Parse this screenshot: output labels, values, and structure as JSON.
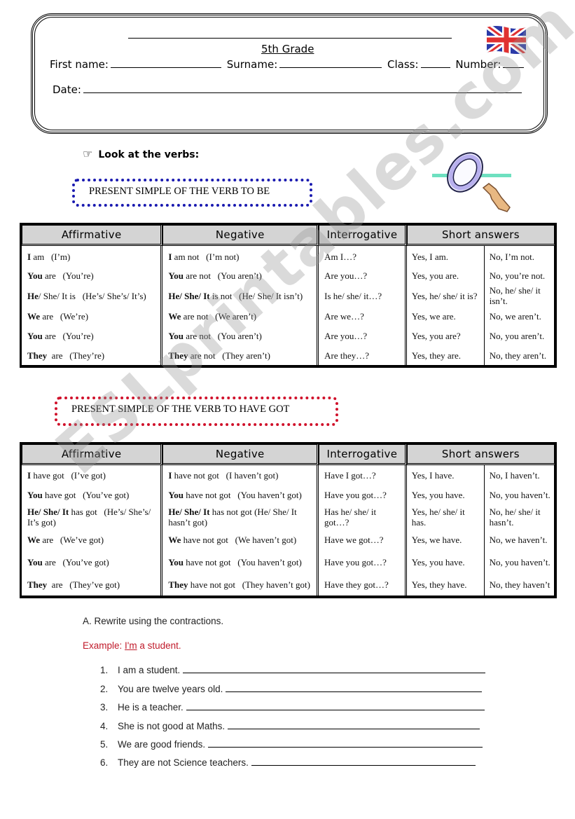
{
  "header": {
    "grade": "5th Grade",
    "first_name_label": "First name:",
    "surname_label": "Surname:",
    "class_label": "Class:",
    "number_label": "Number:",
    "date_label": "Date:",
    "flag_icon": "uk-flag-icon"
  },
  "intro": {
    "pointer_icon": "pointing-hand-icon",
    "pointer_glyph": "☞",
    "look_label": "Look at the verbs:",
    "magnifier_icon": "magnifying-glass-icon"
  },
  "section_to_be": {
    "title": "PRESENT SIMPLE OF THE VERB TO BE",
    "border_color": "#1a1ab0",
    "headers": [
      "Affirmative",
      "Negative",
      "Interrogative",
      "Short answers"
    ],
    "rows": [
      {
        "aff_subj": "I",
        "aff_rest": " am   (I’m)",
        "neg_subj": "I",
        "neg_rest": " am not   (I’m not)",
        "inter": "Am I…?",
        "yes": "Yes, I am.",
        "no": "No, I’m not."
      },
      {
        "aff_subj": "You",
        "aff_rest": " are   (You’re)",
        "neg_subj": "You",
        "neg_rest": " are not   (You aren’t)",
        "inter": "Are you…?",
        "yes": "Yes, you are.",
        "no": "No, you’re not."
      },
      {
        "aff_subj": "He",
        "aff_rest": "/ She/ It is   (He’s/ She’s/ It’s)",
        "neg_subj": "He/ She/ It",
        "neg_rest": " is not   (He/ She/ It isn’t)",
        "inter": "Is he/ she/ it…?",
        "yes": "Yes, he/ she/ it is?",
        "no": "No, he/ she/ it isn’t."
      },
      {
        "aff_subj": "We",
        "aff_rest": " are   (We’re)",
        "neg_subj": "We",
        "neg_rest": " are not   (We aren’t)",
        "inter": "Are we…?",
        "yes": "Yes, we are.",
        "no": "No, we aren’t."
      },
      {
        "aff_subj": "You",
        "aff_rest": " are   (You’re)",
        "neg_subj": "You",
        "neg_rest": " are not   (You aren’t)",
        "inter": "Are you…?",
        "yes": "Yes, you are?",
        "no": "No, you aren’t."
      },
      {
        "aff_subj": "They",
        "aff_rest": "  are   (They’re)",
        "neg_subj": "They",
        "neg_rest": " are not   (They aren’t)",
        "inter": "Are they…?",
        "yes": "Yes, they are.",
        "no": "No, they aren’t."
      }
    ]
  },
  "section_have_got": {
    "title": "PRESENT SIMPLE OF THE VERB TO HAVE GOT",
    "border_color": "#d0102a",
    "headers": [
      "Affirmative",
      "Negative",
      "Interrogative",
      "Short answers"
    ],
    "rows": [
      {
        "aff_subj": "I",
        "aff_rest": " have got   (I’ve got)",
        "neg_subj": "I",
        "neg_rest": " have not got   (I haven’t got)",
        "inter": "Have I got…?",
        "yes": "Yes, I have.",
        "no": "No, I haven’t."
      },
      {
        "aff_subj": "You",
        "aff_rest": " have got   (You’ve got)",
        "neg_subj": "You",
        "neg_rest": " have not got   (You haven’t got)",
        "inter": "Have you got…?",
        "yes": "Yes, you have.",
        "no": "No, you haven’t."
      },
      {
        "aff_subj": "He/ She/ It",
        "aff_rest": " has got   (He’s/ She’s/ It’s got)",
        "neg_subj": "He/ She/ It",
        "neg_rest": " has not got (He/ She/ It hasn’t got)",
        "inter": "Has he/ she/ it got…?",
        "yes": "Yes, he/ she/ it has.",
        "no": "No, he/ she/ it hasn’t."
      },
      {
        "aff_subj": "We",
        "aff_rest": " are   (We’ve got)",
        "neg_subj": "We",
        "neg_rest": " have not got   (We haven’t got)",
        "inter": "Have we got…?",
        "yes": "Yes, we have.",
        "no": "No, we haven’t."
      },
      {
        "aff_subj": "You",
        "aff_rest": " are   (You’ve got)",
        "neg_subj": "You",
        "neg_rest": " have not got   (You haven’t got)",
        "inter": "Have you got…?",
        "yes": "Yes, you have.",
        "no": "No, you haven’t."
      },
      {
        "aff_subj": "They",
        "aff_rest": "  are   (They’ve got)",
        "neg_subj": "They",
        "neg_rest": " have not got   (They haven’t got)",
        "inter": "Have they got…?",
        "yes": "Yes, they have.",
        "no": "No, they haven’t"
      }
    ]
  },
  "exercise": {
    "title": "A. Rewrite using the contractions.",
    "example_prefix": "Example: ",
    "example_underlined": "I'm",
    "example_rest": " a student.",
    "example_color": "#c01a2a",
    "items": [
      {
        "num": "1.",
        "text": "I am a student."
      },
      {
        "num": "2.",
        "text": "You are twelve years old."
      },
      {
        "num": "3.",
        "text": "He is a teacher."
      },
      {
        "num": "4.",
        "text": "She is not good at Maths."
      },
      {
        "num": "5.",
        "text": "We are good friends."
      },
      {
        "num": "6.",
        "text": "They are not Science teachers."
      }
    ]
  },
  "watermark": "ESLprintables.com"
}
